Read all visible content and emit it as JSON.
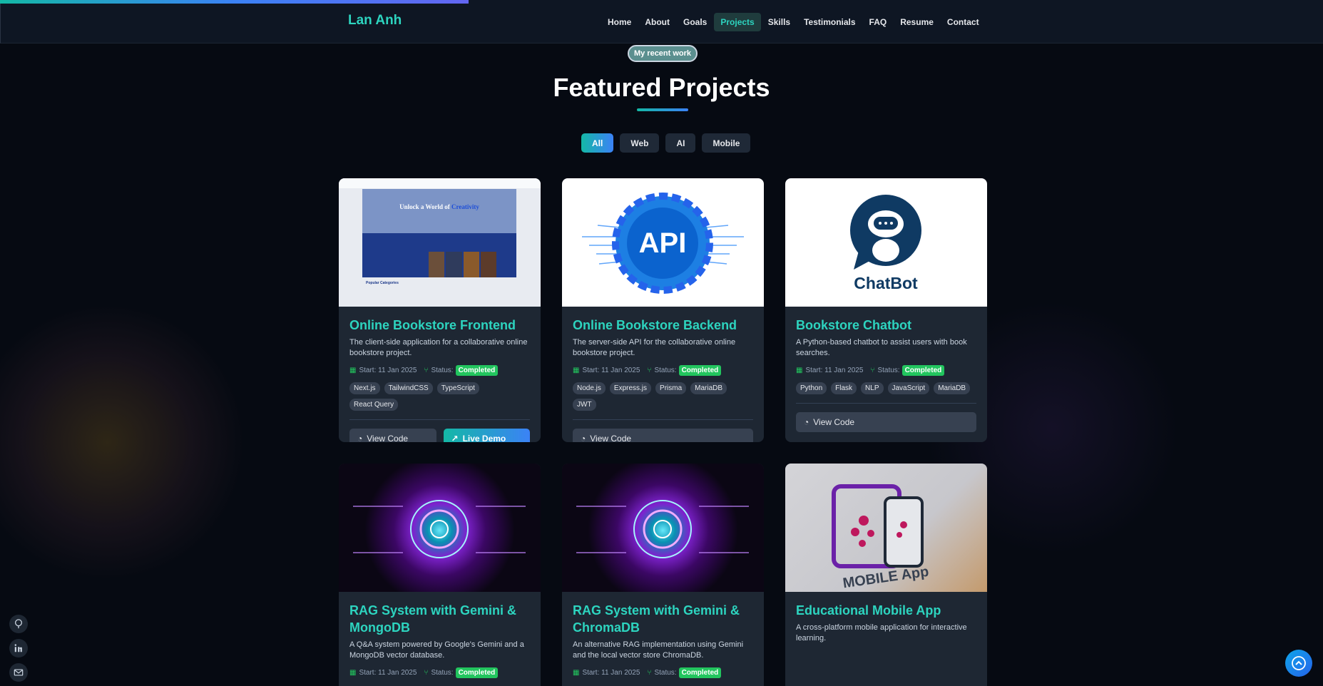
{
  "brand": "Lan Anh",
  "nav": {
    "items": [
      "Home",
      "About",
      "Goals",
      "Projects",
      "Skills",
      "Testimonials",
      "FAQ",
      "Resume",
      "Contact"
    ],
    "active": "Projects"
  },
  "section": {
    "pill": "My recent work",
    "title": "Featured Projects"
  },
  "filters": {
    "items": [
      "All",
      "Web",
      "AI",
      "Mobile"
    ],
    "active": "All"
  },
  "projects": [
    {
      "title": "Online Bookstore Frontend",
      "description": "The client-side application for a collaborative online bookstore project.",
      "start": "Start: 11 Jan 2025",
      "status_label": "Status:",
      "status": "Completed",
      "tags": [
        "Next.js",
        "TailwindCSS",
        "TypeScript",
        "React Query"
      ],
      "view_code": "View Code",
      "live_demo": "Live Demo",
      "thumb": {
        "heading": "Unlock a World of",
        "heading_accent": "Creativity",
        "section_label": "Popular Categories"
      }
    },
    {
      "title": "Online Bookstore Backend",
      "description": "The server-side API for the collaborative online bookstore project.",
      "start": "Start: 11 Jan 2025",
      "status_label": "Status:",
      "status": "Completed",
      "tags": [
        "Node.js",
        "Express.js",
        "Prisma",
        "MariaDB",
        "JWT"
      ],
      "view_code": "View Code",
      "thumb": {
        "text": "API"
      }
    },
    {
      "title": "Bookstore Chatbot",
      "description": "A Python-based chatbot to assist users with book searches.",
      "start": "Start: 11 Jan 2025",
      "status_label": "Status:",
      "status": "Completed",
      "tags": [
        "Python",
        "Flask",
        "NLP",
        "JavaScript",
        "MariaDB"
      ],
      "view_code": "View Code",
      "thumb": {
        "text": "ChatBot"
      }
    },
    {
      "title": "RAG System with Gemini & MongoDB",
      "description": "A Q&A system powered by Google's Gemini and a MongoDB vector database.",
      "start": "Start: 11 Jan 2025",
      "status_label": "Status:",
      "status": "Completed"
    },
    {
      "title": "RAG System with Gemini & ChromaDB",
      "description": "An alternative RAG implementation using Gemini and the local vector store ChromaDB.",
      "start": "Start: 11 Jan 2025",
      "status_label": "Status:",
      "status": "Completed"
    },
    {
      "title": "Educational Mobile App",
      "description": "A cross-platform mobile application for interactive learning.",
      "thumb": {
        "text": "MOBILE App"
      }
    }
  ],
  "social_icons": [
    "github-icon",
    "linkedin-icon",
    "mail-icon"
  ],
  "colors": {
    "accent": "#2dd4bf",
    "status": "#22c55e",
    "background": "#060a12",
    "card": "#1e2733"
  }
}
